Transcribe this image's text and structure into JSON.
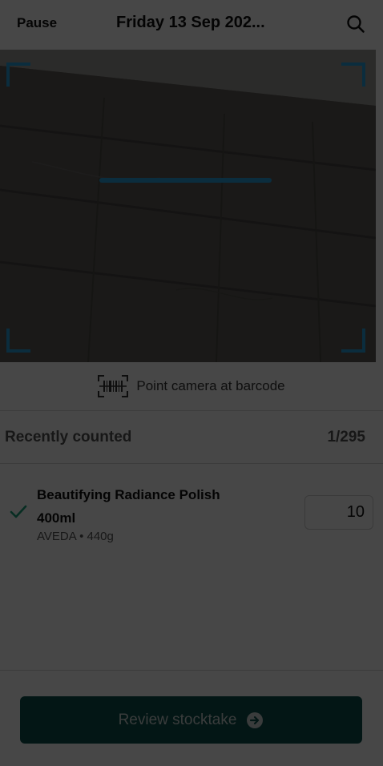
{
  "header": {
    "pause_label": "Pause",
    "title": "Friday 13 Sep 202...",
    "search_icon": "search-icon"
  },
  "scanner": {
    "hint": "Point camera at barcode",
    "hint_icon": "barcode-scan-icon",
    "accent_color": "#2aa3df"
  },
  "recent": {
    "title": "Recently counted",
    "count": "1/295",
    "items": [
      {
        "name_line1": "Beautifying Radiance Polish",
        "name_line2": "400ml",
        "meta": "AVEDA • 440g",
        "quantity": "10",
        "status_icon": "check-icon"
      }
    ]
  },
  "footer": {
    "review_label": "Review stocktake",
    "review_icon": "arrow-right-circle-icon",
    "button_color": "#0d4f4b"
  },
  "overlay": {
    "dimmed": true
  }
}
